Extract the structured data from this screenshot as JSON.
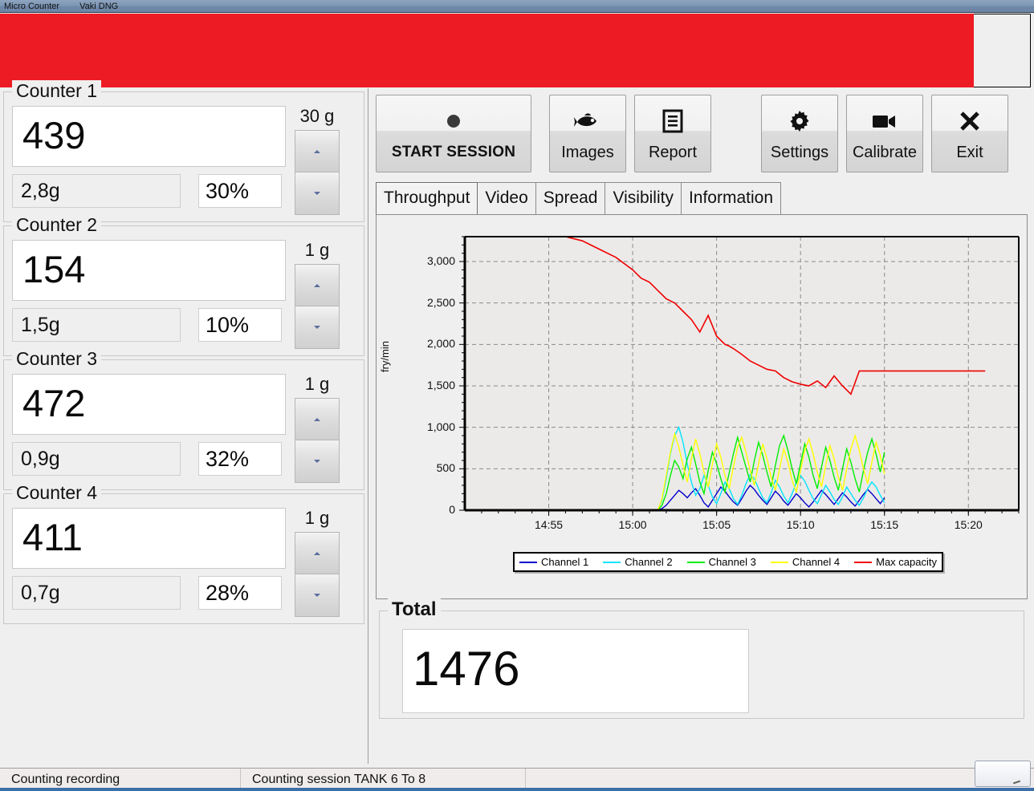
{
  "window": {
    "title_app": "Micro Counter",
    "title_brand": "Vaki DNG",
    "banner_color": "#ed1c24"
  },
  "counters": [
    {
      "name": "Counter 1",
      "count": "439",
      "weight": "2,8g",
      "percent": "30%",
      "grade": "30 g"
    },
    {
      "name": "Counter 2",
      "count": "154",
      "weight": "1,5g",
      "percent": "10%",
      "grade": "1 g"
    },
    {
      "name": "Counter 3",
      "count": "472",
      "weight": "0,9g",
      "percent": "32%",
      "grade": "1 g"
    },
    {
      "name": "Counter 4",
      "count": "411",
      "weight": "0,7g",
      "percent": "28%",
      "grade": "1 g"
    }
  ],
  "toolbar": {
    "start_label": "START SESSION",
    "images_label": "Images",
    "report_label": "Report",
    "settings_label": "Settings",
    "calibrate_label": "Calibrate",
    "exit_label": "Exit"
  },
  "tabs": [
    {
      "label": "Throughput",
      "active": true
    },
    {
      "label": "Video",
      "active": false
    },
    {
      "label": "Spread",
      "active": false
    },
    {
      "label": "Visibility",
      "active": false
    },
    {
      "label": "Information",
      "active": false
    }
  ],
  "total": {
    "label": "Total",
    "value": "1476"
  },
  "statusbar": {
    "left": "Counting recording",
    "middle": "Counting session TANK 6 To 8",
    "right": ""
  },
  "chart_data": {
    "type": "line",
    "title": "",
    "xlabel": "",
    "ylabel": "fry/min",
    "grid": true,
    "legend_position": "bottom",
    "ylim": [
      0,
      3300
    ],
    "yticks": [
      0,
      500,
      1000,
      1500,
      2000,
      2500,
      3000
    ],
    "ytick_labels": [
      "0",
      "500",
      "1,000",
      "1,500",
      "2,000",
      "2,500",
      "3,000"
    ],
    "xlim": [
      "14:53",
      "15:22"
    ],
    "xtick_labels": [
      "14:55",
      "15:00",
      "15:05",
      "15:10",
      "15:15",
      "15:20"
    ],
    "series": [
      {
        "name": "Channel 1",
        "color": "#0000cc",
        "x": [
          15.3,
          15.35,
          15.4,
          15.45,
          15.5,
          15.55,
          15.6,
          15.65,
          15.7,
          15.75,
          15.8,
          15.85,
          15.9,
          15.95,
          16.0,
          16.05,
          16.1,
          16.15,
          16.2,
          16.25,
          16.3,
          16.35,
          16.4,
          16.45,
          16.5,
          16.55,
          16.6,
          16.65,
          16.7,
          16.75,
          16.8,
          16.85,
          16.9,
          16.95,
          17.0,
          17.05,
          17.1,
          17.15,
          17.2,
          17.25,
          17.3,
          17.35,
          17.4,
          17.45,
          17.5,
          17.55,
          17.6,
          17.65,
          17.7,
          17.75,
          17.8,
          17.85,
          17.9,
          17.95,
          18.0
        ],
        "values": [
          0,
          20,
          60,
          120,
          180,
          240,
          200,
          150,
          210,
          260,
          180,
          90,
          40,
          120,
          200,
          280,
          230,
          160,
          100,
          60,
          140,
          230,
          300,
          250,
          180,
          120,
          70,
          150,
          230,
          180,
          110,
          60,
          130,
          200,
          150,
          90,
          40,
          100,
          170,
          240,
          190,
          130,
          70,
          140,
          210,
          160,
          100,
          50,
          120,
          190,
          250,
          200,
          140,
          80,
          150
        ]
      },
      {
        "name": "Channel 2",
        "color": "#00e5ff",
        "x": [
          15.3,
          15.35,
          15.4,
          15.45,
          15.5,
          15.55,
          15.6,
          15.65,
          15.7,
          15.75,
          15.8,
          15.85,
          15.9,
          15.95,
          16.0,
          16.05,
          16.1,
          16.15,
          16.2,
          16.25,
          16.3,
          16.35,
          16.4,
          16.45,
          16.5,
          16.55,
          16.6,
          16.65,
          16.7,
          16.75,
          16.8,
          16.85,
          16.9,
          16.95,
          17.0,
          17.05,
          17.1,
          17.15,
          17.2,
          17.25,
          17.3,
          17.35,
          17.4,
          17.45,
          17.5,
          17.55,
          17.6,
          17.65,
          17.7,
          17.75,
          17.8,
          17.85,
          17.9,
          17.95,
          18.0
        ],
        "values": [
          0,
          120,
          380,
          680,
          900,
          1000,
          820,
          560,
          340,
          180,
          260,
          420,
          300,
          160,
          80,
          200,
          340,
          260,
          140,
          70,
          180,
          320,
          430,
          380,
          260,
          150,
          90,
          210,
          360,
          280,
          170,
          90,
          200,
          340,
          420,
          350,
          240,
          140,
          80,
          190,
          300,
          220,
          130,
          70,
          160,
          280,
          200,
          120,
          60,
          150,
          260,
          340,
          280,
          180,
          90
        ]
      },
      {
        "name": "Channel 3",
        "color": "#00ee00",
        "x": [
          15.3,
          15.35,
          15.4,
          15.45,
          15.5,
          15.55,
          15.6,
          15.65,
          15.7,
          15.75,
          15.8,
          15.85,
          15.9,
          15.95,
          16.0,
          16.05,
          16.1,
          16.15,
          16.2,
          16.25,
          16.3,
          16.35,
          16.4,
          16.45,
          16.5,
          16.55,
          16.6,
          16.65,
          16.7,
          16.75,
          16.8,
          16.85,
          16.9,
          16.95,
          17.0,
          17.05,
          17.1,
          17.15,
          17.2,
          17.25,
          17.3,
          17.35,
          17.4,
          17.45,
          17.5,
          17.55,
          17.6,
          17.65,
          17.7,
          17.75,
          17.8,
          17.85,
          17.9,
          17.95,
          18.0
        ],
        "values": [
          0,
          60,
          200,
          420,
          600,
          520,
          380,
          620,
          760,
          560,
          340,
          200,
          480,
          700,
          560,
          380,
          220,
          450,
          680,
          880,
          700,
          520,
          340,
          600,
          820,
          660,
          460,
          280,
          540,
          780,
          900,
          720,
          500,
          320,
          560,
          800,
          640,
          420,
          260,
          520,
          760,
          600,
          400,
          240,
          500,
          740,
          580,
          380,
          220,
          480,
          700,
          860,
          680,
          460,
          700
        ]
      },
      {
        "name": "Channel 4",
        "color": "#ffff00",
        "x": [
          15.3,
          15.35,
          15.4,
          15.45,
          15.5,
          15.55,
          15.6,
          15.65,
          15.7,
          15.75,
          15.8,
          15.85,
          15.9,
          15.95,
          16.0,
          16.05,
          16.1,
          16.15,
          16.2,
          16.25,
          16.3,
          16.35,
          16.4,
          16.45,
          16.5,
          16.55,
          16.6,
          16.65,
          16.7,
          16.75,
          16.8,
          16.85,
          16.9,
          16.95,
          17.0,
          17.05,
          17.1,
          17.15,
          17.2,
          17.25,
          17.3,
          17.35,
          17.4,
          17.45,
          17.5,
          17.55,
          17.6,
          17.65,
          17.7,
          17.75,
          17.8,
          17.85,
          17.9,
          17.95,
          18.0
        ],
        "values": [
          0,
          140,
          420,
          700,
          920,
          760,
          540,
          340,
          620,
          860,
          680,
          460,
          280,
          560,
          800,
          640,
          420,
          260,
          520,
          760,
          880,
          700,
          480,
          300,
          560,
          800,
          620,
          400,
          240,
          500,
          740,
          580,
          360,
          220,
          480,
          720,
          860,
          680,
          460,
          280,
          540,
          780,
          620,
          400,
          240,
          500,
          740,
          900,
          720,
          500,
          320,
          580,
          820,
          660,
          440
        ]
      },
      {
        "name": "Max capacity",
        "color": "#ee0000",
        "x": [
          14.2,
          14.4,
          14.6,
          14.8,
          15.0,
          15.1,
          15.2,
          15.3,
          15.4,
          15.5,
          15.6,
          15.7,
          15.8,
          15.9,
          16.0,
          16.05,
          16.1,
          16.15,
          16.2,
          16.3,
          16.4,
          16.5,
          16.6,
          16.7,
          16.8,
          16.9,
          17.0,
          17.1,
          17.2,
          17.3,
          17.4,
          17.5,
          17.6,
          17.7,
          17.8,
          17.9,
          18.0,
          18.4,
          18.8,
          19.2
        ],
        "values": [
          3300,
          3250,
          3150,
          3050,
          2900,
          2800,
          2750,
          2650,
          2550,
          2500,
          2400,
          2300,
          2150,
          2350,
          2100,
          2050,
          2000,
          1980,
          1950,
          1880,
          1800,
          1750,
          1700,
          1680,
          1600,
          1550,
          1520,
          1500,
          1560,
          1480,
          1620,
          1500,
          1400,
          1680,
          1680,
          1680,
          1680,
          1680,
          1680,
          1680
        ]
      }
    ]
  }
}
